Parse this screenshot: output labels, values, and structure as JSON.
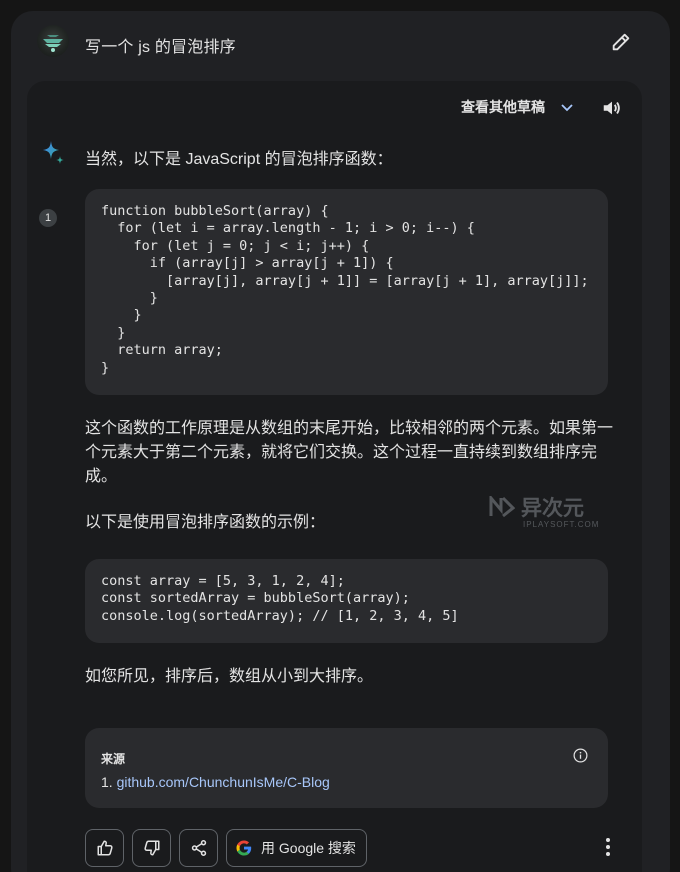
{
  "prompt": {
    "text": "写一个 js 的冒泡排序"
  },
  "response": {
    "drafts_label": "查看其他草稿",
    "intro": "当然，以下是 JavaScript 的冒泡排序函数：",
    "citation_number": "1",
    "code_block_1": "function bubbleSort(array) {\n  for (let i = array.length - 1; i > 0; i--) {\n    for (let j = 0; j < i; j++) {\n      if (array[j] > array[j + 1]) {\n        [array[j], array[j + 1]] = [array[j + 1], array[j]];\n      }\n    }\n  }\n  return array;\n}",
    "paragraph_1": "这个函数的工作原理是从数组的末尾开始，比较相邻的两个元素。如果第一个元素大于第二个元素，就将它们交换。这个过程一直持续到数组排序完成。",
    "paragraph_2": "以下是使用冒泡排序函数的示例：",
    "code_block_2": "const array = [5, 3, 1, 2, 4];\nconst sortedArray = bubbleSort(array);\nconsole.log(sortedArray); // [1, 2, 3, 4, 5]",
    "paragraph_3": "如您所见，排序后，数组从小到大排序。"
  },
  "watermark": {
    "main": "异次元",
    "sub": "IPLAYSOFT.COM"
  },
  "sources": {
    "title": "来源",
    "items": [
      {
        "index": "1.",
        "link": "github.com/ChunchunIsMe/C-Blog"
      }
    ]
  },
  "actions": {
    "google_search_label": "用 Google 搜索"
  },
  "icons": {
    "edit": "pencil-icon",
    "drafts_toggle": "chevron-down-icon",
    "speaker": "speaker-icon",
    "gemini": "sparkle-icon",
    "info": "info-icon",
    "thumbs_up": "thumbs-up-icon",
    "thumbs_down": "thumbs-down-icon",
    "share": "share-icon",
    "google": "google-g-icon",
    "more": "more-vert-icon"
  },
  "colors": {
    "background": "#151515",
    "panel": "#202124",
    "card": "#1a1b1d",
    "code_bg": "#2a2b2e",
    "link": "#a8c7fa",
    "gemini_blue": "#4285f4",
    "gemini_teal": "#34a89a"
  }
}
